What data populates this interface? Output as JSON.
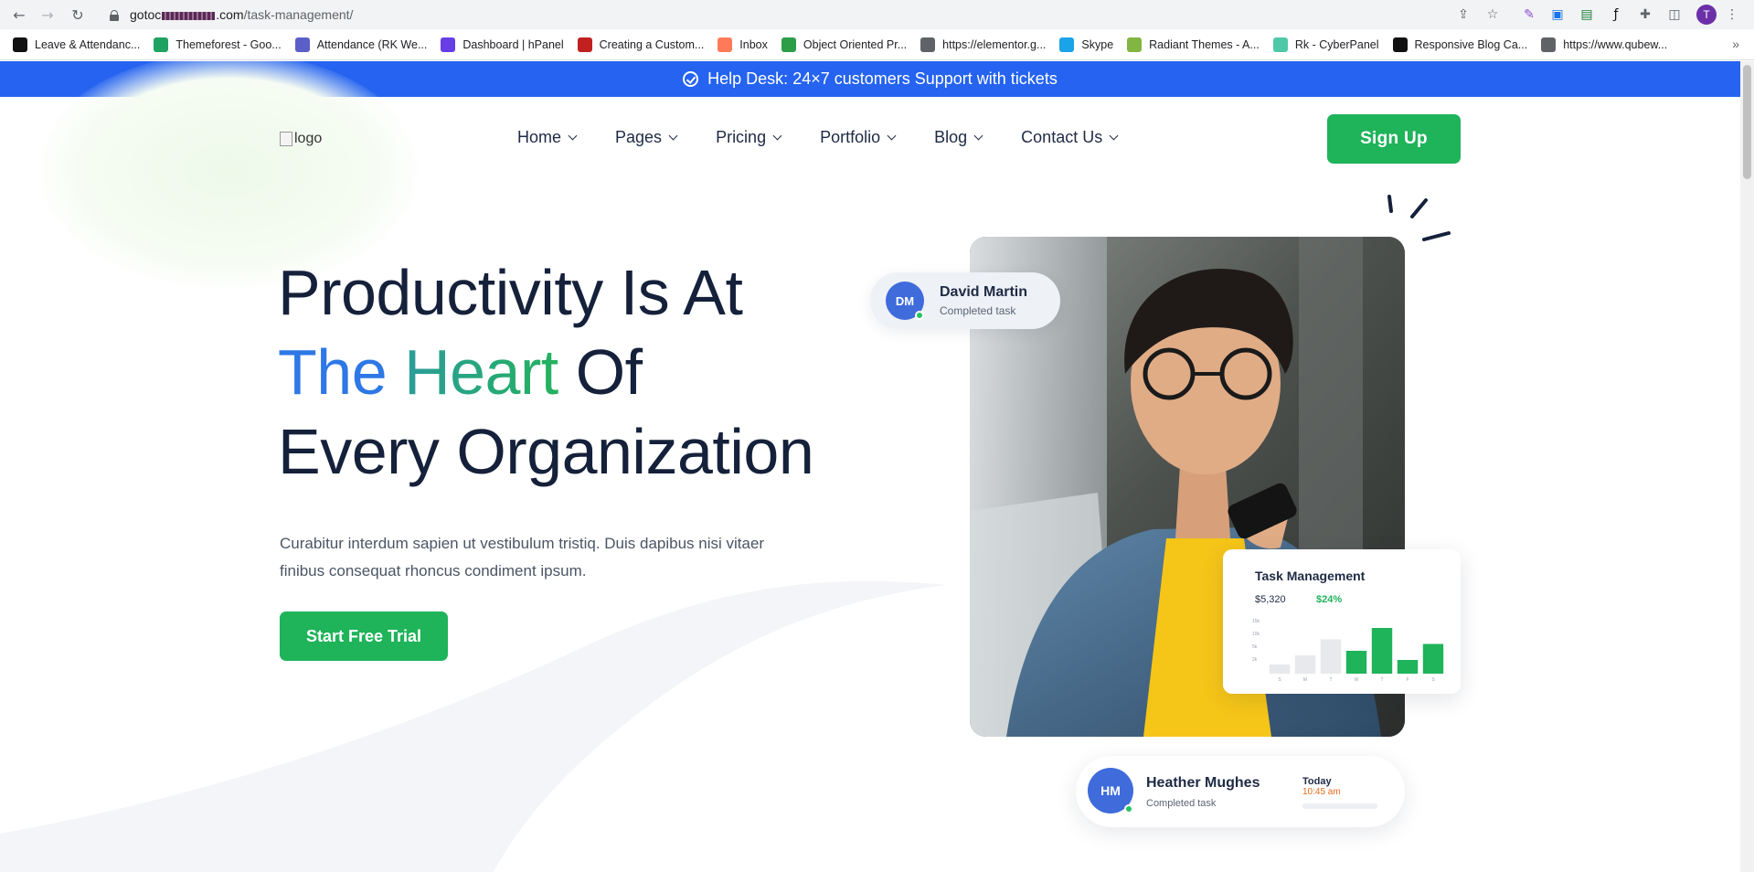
{
  "browser": {
    "url_host_start": "gotoc",
    "url_host_end": ".com",
    "url_path": "/task-management/",
    "profile_initial": "T",
    "bookmarks": [
      {
        "label": "Leave & Attendanc...",
        "icon": "x-logo-icon",
        "color": "#111111"
      },
      {
        "label": "Themeforest - Goo...",
        "icon": "google-drive-icon",
        "color": "#1ea362"
      },
      {
        "label": "Attendance (RK We...",
        "icon": "teams-icon",
        "color": "#5b5fc7"
      },
      {
        "label": "Dashboard | hPanel",
        "icon": "hostinger-icon",
        "color": "#673de6"
      },
      {
        "label": "Creating a Custom...",
        "icon": "bookmark-red-icon",
        "color": "#c21f1f"
      },
      {
        "label": "Inbox",
        "icon": "hubspot-icon",
        "color": "#ff7a59"
      },
      {
        "label": "Object Oriented Pr...",
        "icon": "leaf-icon",
        "color": "#2e9d48"
      },
      {
        "label": "https://elementor.g...",
        "icon": "globe-icon",
        "color": "#5f6368"
      },
      {
        "label": "Skype",
        "icon": "skype-icon",
        "color": "#1aa3e8"
      },
      {
        "label": "Radiant Themes - A...",
        "icon": "envato-icon",
        "color": "#82b541"
      },
      {
        "label": "Rk - CyberPanel",
        "icon": "cyberpanel-icon",
        "color": "#4ec9a8"
      },
      {
        "label": "Responsive Blog Ca...",
        "icon": "codepen-icon",
        "color": "#111111"
      },
      {
        "label": "https://www.qubew...",
        "icon": "globe-icon",
        "color": "#5f6368"
      }
    ]
  },
  "helpbar": {
    "text": "Help Desk: 24×7 customers Support with tickets"
  },
  "header": {
    "logo_alt": "logo",
    "menu": [
      "Home",
      "Pages",
      "Pricing",
      "Portfolio",
      "Blog",
      "Contact Us"
    ],
    "signup_label": "Sign Up"
  },
  "hero": {
    "title_line1": "Productivity Is At",
    "title_line2_a": "The",
    "title_line2_b": "Heart",
    "title_line2_c": "Of",
    "title_line3": "Every Organization",
    "description": "Curabitur interdum sapien ut vestibulum tristiq. Duis dapibus nisi vitaer finibus consequat rhoncus condiment ipsum.",
    "cta_label": "Start Free Trial"
  },
  "card_dm": {
    "initials": "DM",
    "name": "David Martin",
    "status": "Completed task"
  },
  "card_task": {
    "title": "Task Management",
    "value": "$5,320",
    "percent": "$24%"
  },
  "card_hm": {
    "initials": "HM",
    "name": "Heather Mughes",
    "status": "Completed task",
    "day": "Today",
    "time": "10:45 am"
  },
  "colors": {
    "brand_blue": "#2563f0",
    "brand_green": "#1fb35a",
    "text_dark": "#15213a"
  },
  "chart_data": {
    "type": "bar",
    "categories": [
      "S",
      "M",
      "T",
      "W",
      "T",
      "F",
      "S"
    ],
    "values": [
      4,
      8,
      15,
      10,
      20,
      6,
      13
    ],
    "highlighted": [
      false,
      false,
      false,
      true,
      true,
      true,
      true
    ],
    "ytick_labels": [
      "15k",
      "10k",
      "5k",
      "2k"
    ],
    "ylim": [
      0,
      24
    ]
  }
}
